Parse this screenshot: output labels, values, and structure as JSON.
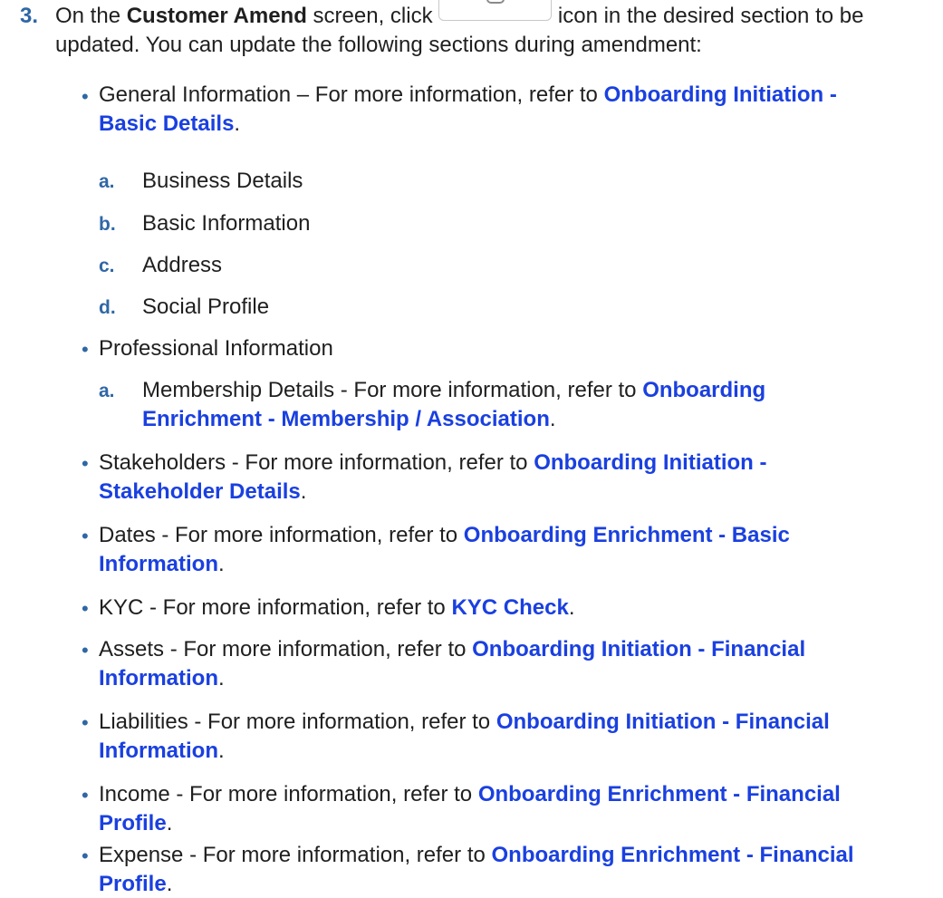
{
  "step": {
    "number": "3.",
    "intro_a": "On the ",
    "screen_name": "Customer Amend",
    "intro_b": " screen, click ",
    "intro_c": " icon in the desired section to be",
    "intro_line2": "updated. You can update the following sections during amendment:"
  },
  "icons": {
    "edit": "edit-icon"
  },
  "colors": {
    "numbering": "#2f67a6",
    "link": "#1a40e0",
    "text": "#1f1f1f"
  },
  "sections": [
    {
      "bullet": "•",
      "text": "General Information – For more information, refer to ",
      "link_line1": "Onboarding Initiation -",
      "link_line2": "Basic Details",
      "tail": ".",
      "subitems": [
        {
          "letter": "a.",
          "text": "Business Details"
        },
        {
          "letter": "b.",
          "text": "Basic Information"
        },
        {
          "letter": "c.",
          "text": "Address"
        },
        {
          "letter": "d.",
          "text": "Social Profile"
        }
      ]
    },
    {
      "bullet": "•",
      "text": "Professional Information",
      "subitems": [
        {
          "letter": "a.",
          "text": "Membership Details - For more information, refer to ",
          "link_line1": "Onboarding",
          "link_line2": "Enrichment - Membership / Association",
          "tail": "."
        }
      ]
    },
    {
      "bullet": "•",
      "text": "Stakeholders - For more information, refer to ",
      "link_line1": "Onboarding Initiation -",
      "link_line2": "Stakeholder Details",
      "tail": "."
    },
    {
      "bullet": "•",
      "text": "Dates - For more information, refer to ",
      "link_line1": "Onboarding Enrichment - Basic",
      "link_line2": "Information",
      "tail": "."
    },
    {
      "bullet": "•",
      "text": "KYC - For more information, refer to ",
      "link": "KYC Check",
      "tail": "."
    },
    {
      "bullet": "•",
      "text": "Assets - For more information, refer to ",
      "link_line1": "Onboarding Initiation - Financial",
      "link_line2": "Information",
      "tail": "."
    },
    {
      "bullet": "•",
      "text": "Liabilities - For more information, refer to ",
      "link_line1": "Onboarding Initiation - Financial",
      "link_line2": "Information",
      "tail": "."
    },
    {
      "bullet": "•",
      "text": "Income - For more information, refer to ",
      "link_line1": "Onboarding Enrichment - Financial",
      "link_line2": "Profile",
      "tail": "."
    },
    {
      "bullet": "•",
      "text": "Expense - For more information, refer to ",
      "link_line1": "Onboarding Enrichment - Financial",
      "link_line2": "Profile",
      "tail": "."
    }
  ]
}
